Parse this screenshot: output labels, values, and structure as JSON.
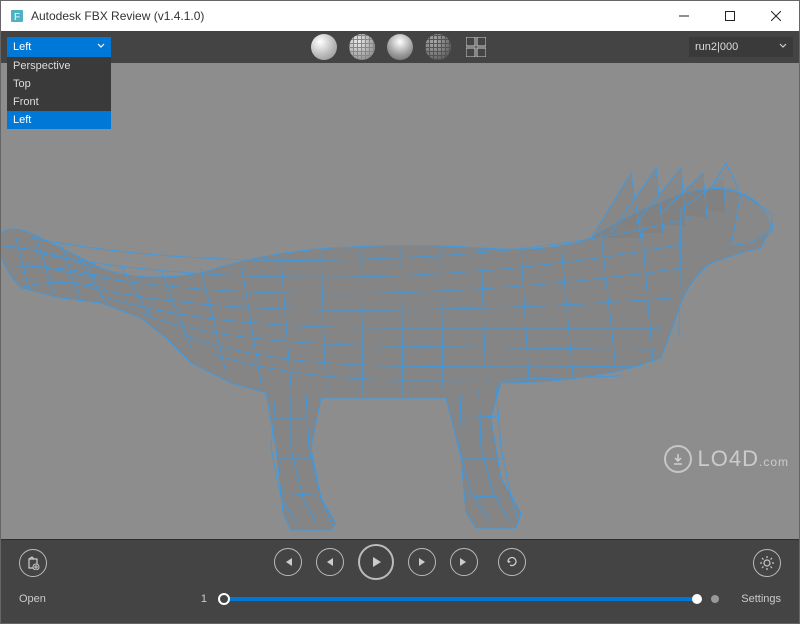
{
  "window": {
    "title": "Autodesk FBX Review (v1.4.1.0)",
    "icon_letter": "F",
    "controls": {
      "minimize": "minimize-icon",
      "maximize": "maximize-icon",
      "close": "close-icon"
    }
  },
  "toolbar": {
    "view_selector": {
      "value": "Left",
      "options": [
        "Perspective",
        "Top",
        "Front",
        "Left"
      ],
      "highlighted": "Left"
    },
    "shading_modes": [
      {
        "name": "smooth-shaded-icon"
      },
      {
        "name": "wireframe-shaded-icon"
      },
      {
        "name": "lit-icon"
      },
      {
        "name": "wireframe-dark-icon"
      },
      {
        "name": "multiview-icon"
      }
    ],
    "animation_selector": {
      "value": "run2|000"
    }
  },
  "viewport": {
    "background_color": "#8d8d8d",
    "wireframe_color": "#3a9be8",
    "model_description": "wolf-wireframe-left-view"
  },
  "transport": {
    "buttons": {
      "first": "first-frame-icon",
      "prev": "prev-frame-icon",
      "play": "play-icon",
      "next": "next-frame-icon",
      "last": "last-frame-icon",
      "loop": "loop-icon"
    }
  },
  "footer": {
    "open_label": "Open",
    "open_icon": "open-file-icon",
    "current_frame": "1",
    "settings_label": "Settings",
    "settings_icon": "gear-icon"
  },
  "watermark": {
    "text": "LO4D",
    "suffix": ".com"
  },
  "colors": {
    "accent": "#0078d7",
    "toolbar_bg": "#444444",
    "viewport_bg": "#8d8d8d"
  }
}
